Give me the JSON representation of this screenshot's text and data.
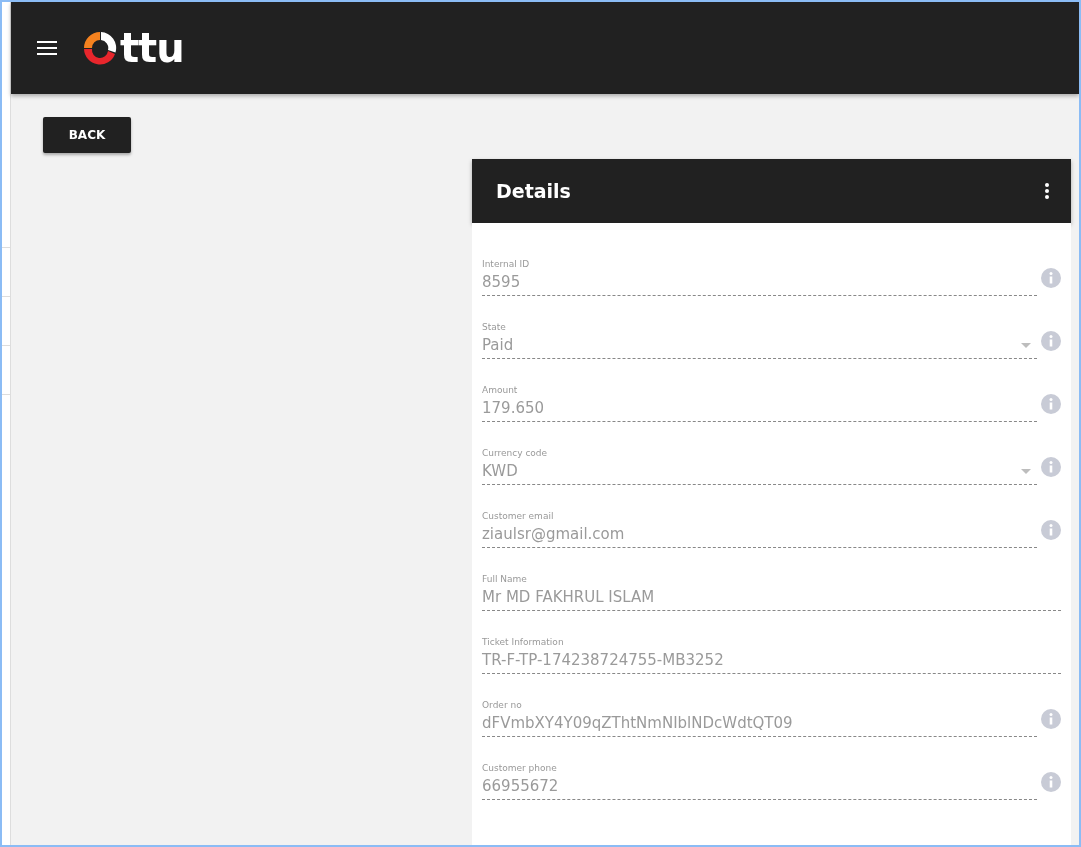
{
  "header": {
    "logo_text": "ttu"
  },
  "back_button": {
    "label": "BACK"
  },
  "details": {
    "title": "Details",
    "fields": [
      {
        "label": "Internal ID",
        "value": "8595",
        "kind": "text",
        "info": true
      },
      {
        "label": "State",
        "value": "Paid",
        "kind": "select",
        "info": true
      },
      {
        "label": "Amount",
        "value": "179.650",
        "kind": "text",
        "info": true
      },
      {
        "label": "Currency code",
        "value": "KWD",
        "kind": "select",
        "info": true
      },
      {
        "label": "Customer email",
        "value": "ziaulsr@gmail.com",
        "kind": "text",
        "info": true
      },
      {
        "label": "Full Name",
        "value": "Mr MD FAKHRUL ISLAM",
        "kind": "text",
        "info": false
      },
      {
        "label": "Ticket Information",
        "value": "TR-F-TP-174238724755-MB3252",
        "kind": "text",
        "info": false
      },
      {
        "label": "Order no",
        "value": "dFVmbXY4Y09qZThtNmNIblNDcWdtQT09",
        "kind": "text",
        "info": true
      },
      {
        "label": "Customer phone",
        "value": "66955672",
        "kind": "text",
        "info": true
      }
    ]
  }
}
